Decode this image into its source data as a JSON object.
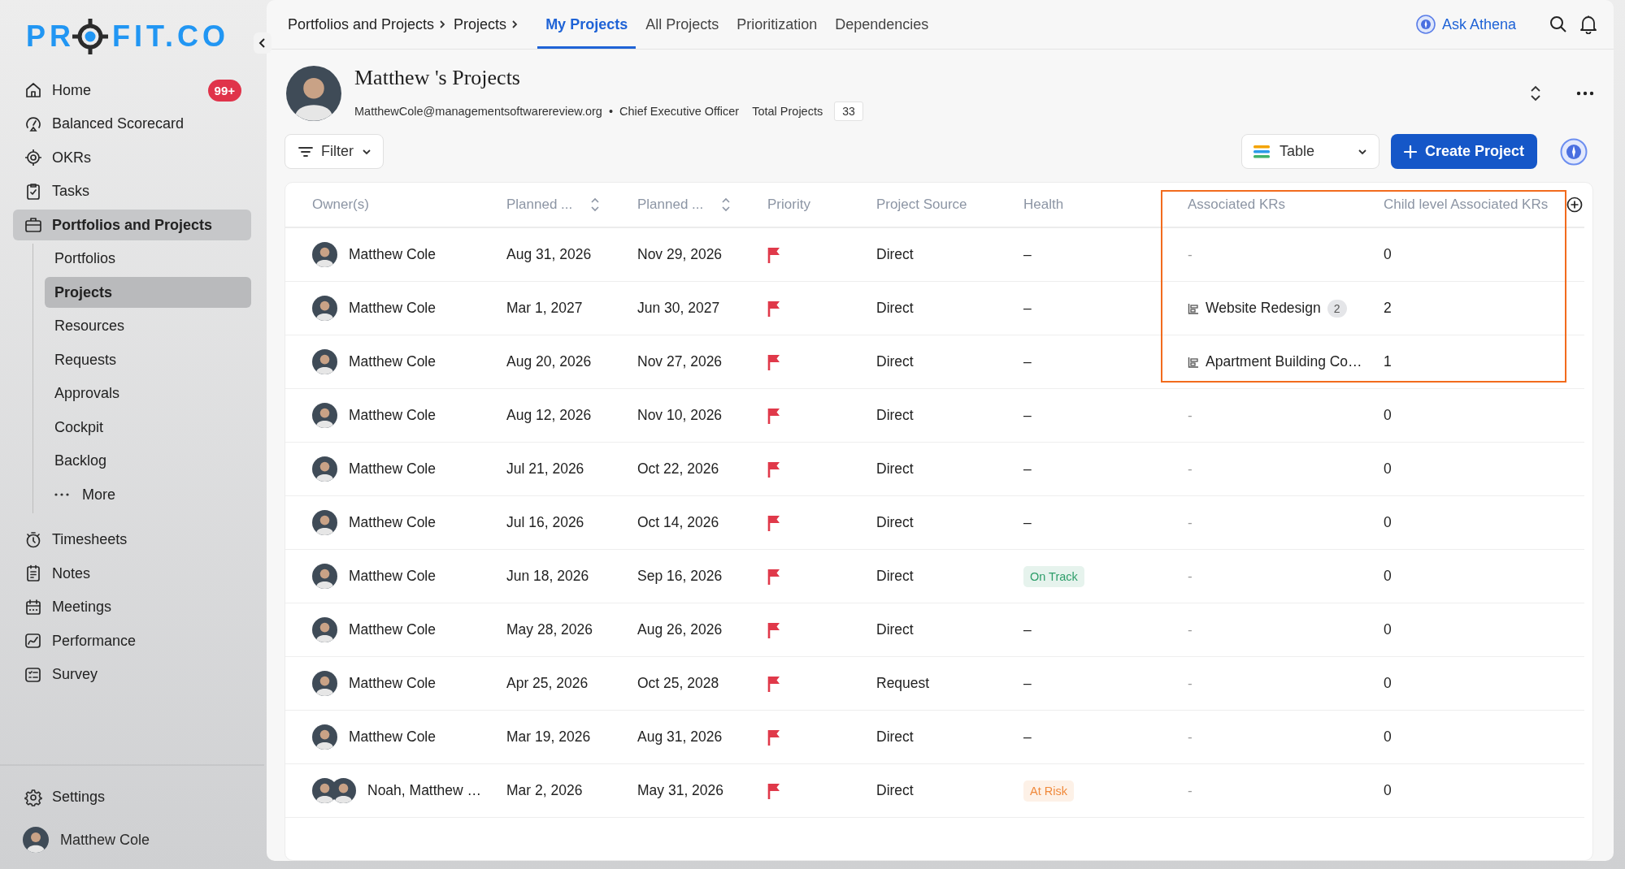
{
  "sidebar": {
    "logo": {
      "parts": [
        "PR",
        "FIT.CO"
      ]
    },
    "items": [
      {
        "label": "Home",
        "badge": "99+",
        "selected": false
      },
      {
        "label": "Balanced Scorecard",
        "selected": false
      },
      {
        "label": "OKRs",
        "selected": false
      },
      {
        "label": "Tasks",
        "selected": false
      },
      {
        "label": "Portfolios and Projects",
        "selected": true,
        "expanded": true,
        "children": [
          {
            "label": "Portfolios",
            "kind": "link",
            "selected": false
          },
          {
            "label": "Projects",
            "kind": "link",
            "selected": true
          },
          {
            "label": "Resources",
            "kind": "link",
            "selected": false
          },
          {
            "label": "Requests",
            "kind": "link",
            "selected": false
          },
          {
            "label": "Approvals",
            "kind": "link",
            "selected": false
          },
          {
            "label": "Cockpit",
            "kind": "link",
            "selected": false
          },
          {
            "label": "Backlog",
            "kind": "link",
            "selected": false
          },
          {
            "label": "More",
            "kind": "more",
            "selected": false
          }
        ]
      },
      {
        "label": "Timesheets",
        "selected": false
      },
      {
        "label": "Notes",
        "selected": false
      },
      {
        "label": "Meetings",
        "selected": false
      },
      {
        "label": "Performance",
        "selected": false
      },
      {
        "label": "Survey",
        "selected": false
      }
    ],
    "footer": {
      "settings": "Settings",
      "user": "Matthew Cole"
    }
  },
  "topbar": {
    "breadcrumbs": [
      "Portfolios and Projects",
      "Projects"
    ],
    "tabs": [
      {
        "label": "My Projects",
        "selected": true
      },
      {
        "label": "All Projects",
        "selected": false
      },
      {
        "label": "Prioritization",
        "selected": false
      },
      {
        "label": "Dependencies",
        "selected": false
      }
    ],
    "ask": "Ask Athena"
  },
  "profile": {
    "title": "Matthew 's Projects",
    "email": "MatthewCole@managementsoftwarereview.org",
    "separator": "•",
    "role": "Chief Executive Officer",
    "total_label": "Total Projects",
    "total": "33"
  },
  "toolbar": {
    "filter": "Filter",
    "view": "Table",
    "create": "Create Project"
  },
  "table": {
    "columns": [
      {
        "label": "Owner(s)",
        "sortable": false
      },
      {
        "label": "Planned ...",
        "sortable": true
      },
      {
        "label": "Planned ...",
        "sortable": true
      },
      {
        "label": "Priority",
        "sortable": false
      },
      {
        "label": "Project Source",
        "sortable": false
      },
      {
        "label": "Health",
        "sortable": false
      },
      {
        "label": "Associated KRs",
        "sortable": false
      },
      {
        "label": "Child level Associated KRs",
        "sortable": false
      }
    ],
    "rows": [
      {
        "owner": "Matthew Cole",
        "start": "Aug 31, 2026",
        "end": "Nov 29, 2026",
        "flagged": true,
        "source": "Direct",
        "health": {
          "kind": "dash",
          "text": "–"
        },
        "kr": {
          "kind": "none",
          "text": "-"
        },
        "child": "0"
      },
      {
        "owner": "Matthew Cole",
        "start": "Mar 1, 2027",
        "end": "Jun 30, 2027",
        "flagged": true,
        "source": "Direct",
        "health": {
          "kind": "dash",
          "text": "–"
        },
        "kr": {
          "kind": "kr",
          "text": "Website Redesign",
          "count": "2"
        },
        "child": "2"
      },
      {
        "owner": "Matthew Cole",
        "start": "Aug 20, 2026",
        "end": "Nov 27, 2026",
        "flagged": true,
        "source": "Direct",
        "health": {
          "kind": "dash",
          "text": "–"
        },
        "kr": {
          "kind": "kr",
          "text": "Apartment Building Co…"
        },
        "child": "1"
      },
      {
        "owner": "Matthew Cole",
        "start": "Aug 12, 2026",
        "end": "Nov 10, 2026",
        "flagged": true,
        "source": "Direct",
        "health": {
          "kind": "dash",
          "text": "–"
        },
        "kr": {
          "kind": "none",
          "text": "-"
        },
        "child": "0"
      },
      {
        "owner": "Matthew Cole",
        "start": "Jul 21, 2026",
        "end": "Oct 22, 2026",
        "flagged": true,
        "source": "Direct",
        "health": {
          "kind": "dash",
          "text": "–"
        },
        "kr": {
          "kind": "none",
          "text": "-"
        },
        "child": "0"
      },
      {
        "owner": "Matthew Cole",
        "start": "Jul 16, 2026",
        "end": "Oct 14, 2026",
        "flagged": true,
        "source": "Direct",
        "health": {
          "kind": "dash",
          "text": "–"
        },
        "kr": {
          "kind": "none",
          "text": "-"
        },
        "child": "0"
      },
      {
        "owner": "Matthew Cole",
        "start": "Jun 18, 2026",
        "end": "Sep 16, 2026",
        "flagged": true,
        "source": "Direct",
        "health": {
          "kind": "badge",
          "text": "On Track",
          "color": "#2e9e6a"
        },
        "kr": {
          "kind": "none",
          "text": "-"
        },
        "child": "0"
      },
      {
        "owner": "Matthew Cole",
        "start": "May 28, 2026",
        "end": "Aug 26, 2026",
        "flagged": true,
        "source": "Direct",
        "health": {
          "kind": "dash",
          "text": "–"
        },
        "kr": {
          "kind": "none",
          "text": "-"
        },
        "child": "0"
      },
      {
        "owner": "Matthew Cole",
        "start": "Apr 25, 2026",
        "end": "Oct 25, 2028",
        "flagged": true,
        "source": "Request",
        "health": {
          "kind": "dash",
          "text": "–"
        },
        "kr": {
          "kind": "none",
          "text": "-"
        },
        "child": "0"
      },
      {
        "owner": "Matthew Cole",
        "start": "Mar 19, 2026",
        "end": "Aug 31, 2026",
        "flagged": true,
        "source": "Direct",
        "health": {
          "kind": "dash",
          "text": "–"
        },
        "kr": {
          "kind": "none",
          "text": "-"
        },
        "child": "0"
      },
      {
        "owner": "Noah, Matthew …",
        "start": "Mar 2, 2026",
        "end": "May 31, 2026",
        "flagged": true,
        "source": "Direct",
        "health": {
          "kind": "badge",
          "text": "At Risk",
          "color": "#f08a3c"
        },
        "kr": {
          "kind": "none",
          "text": "-"
        },
        "child": "0"
      }
    ],
    "annotation": {
      "kind": "highlight_box"
    }
  }
}
